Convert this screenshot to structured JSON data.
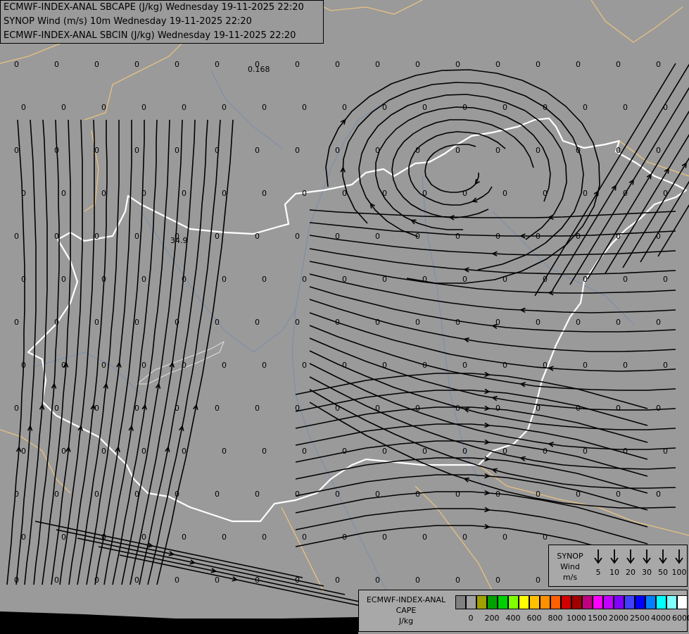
{
  "header": {
    "line1": "ECMWF-INDEX-ANAL SBCAPE (J/kg) Wednesday 19-11-2025 22:20",
    "line2": "SYNOP Wind (m/s) 10m Wednesday 19-11-2025 22:20",
    "line3": "ECMWF-INDEX-ANAL SBCIN (J/kg) Wednesday 19-11-2025 22:20"
  },
  "map_values": {
    "special": [
      "0.168",
      "34.9"
    ],
    "zero_label": "0"
  },
  "colors": {
    "background": "#9a9a9a",
    "streamline": "#000000",
    "country_border": "#ffffff",
    "neighbor_border": "#e8c080",
    "rivers": "#5a7fbf"
  },
  "synop_legend": {
    "title_lines": [
      "SYNOP",
      "Wind",
      "m/s"
    ],
    "speeds": [
      "5",
      "10",
      "20",
      "30",
      "50",
      "100"
    ]
  },
  "cape_legend": {
    "title_lines": [
      "ECMWF-INDEX-ANAL",
      "CAPE",
      "J/kg"
    ],
    "swatch_colors": [
      "#808080",
      "#a0a0a0",
      "#a0a000",
      "#00a000",
      "#00d000",
      "#80ff00",
      "#ffff00",
      "#ffc000",
      "#ff9000",
      "#ff6000",
      "#d00000",
      "#a00000",
      "#c00080",
      "#ff00ff",
      "#c000ff",
      "#8000ff",
      "#4040ff",
      "#0000ff",
      "#0080ff",
      "#00ffff",
      "#80ffff",
      "#ffffff"
    ],
    "tick_labels": [
      "0",
      "200",
      "400",
      "600",
      "800",
      "1000",
      "1500",
      "2000",
      "2500",
      "4000",
      "6000"
    ]
  }
}
